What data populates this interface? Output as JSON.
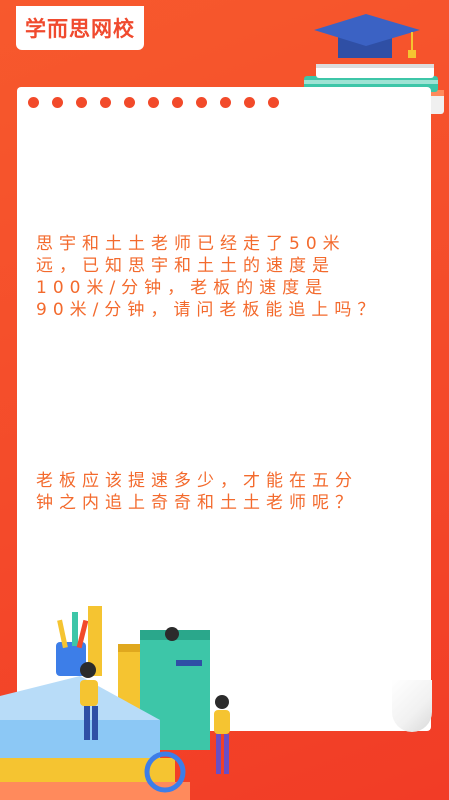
{
  "brand": {
    "logo_text": "学而思网校"
  },
  "content": {
    "question_1": "思宇和土土老师已经走了50米\n远，已知思宇和土土的速度是\n100米/分钟，老板的速度是\n90米/分钟，请问老板能追上吗？",
    "question_2": "老板应该提速多少，才能在五分\n钟之内追上奇奇和土土老师呢？"
  },
  "colors": {
    "background": "#f44a2a",
    "accent_text": "#f36a2d",
    "paper": "#ffffff"
  },
  "icons": [
    "graduation-cap-icon",
    "book-stack-icon",
    "school-scene-illustration"
  ]
}
